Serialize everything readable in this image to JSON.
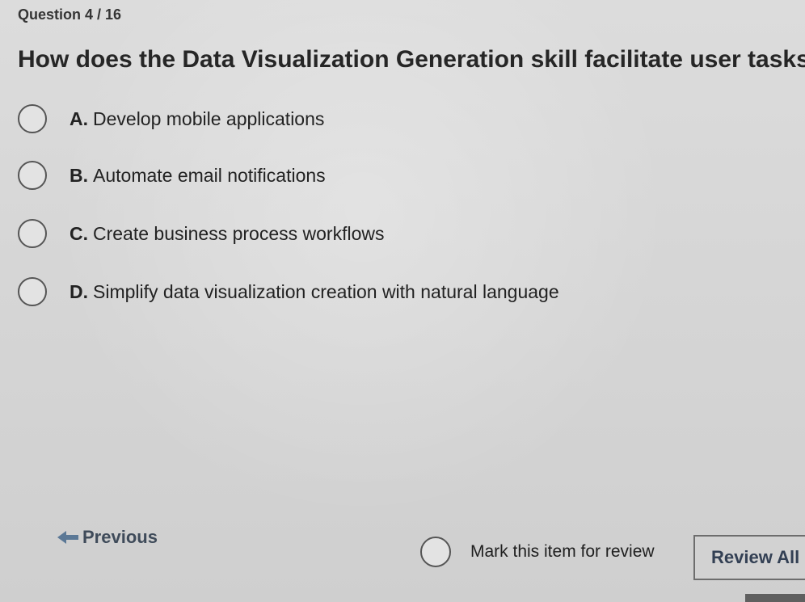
{
  "question": {
    "number_label": "Question 4 / 16",
    "text": "How does the Data Visualization Generation skill facilitate user tasks"
  },
  "answers": [
    {
      "letter": "A.",
      "text": "Develop mobile applications"
    },
    {
      "letter": "B.",
      "text": "Automate email notifications"
    },
    {
      "letter": "C.",
      "text": "Create business process workflows"
    },
    {
      "letter": "D.",
      "text": "Simplify data visualization creation with natural language"
    }
  ],
  "navigation": {
    "previous_label": "Previous",
    "mark_review_label": "Mark this item for review",
    "review_all_label": "Review All",
    "arrow_icon": "arrow-left-icon"
  }
}
